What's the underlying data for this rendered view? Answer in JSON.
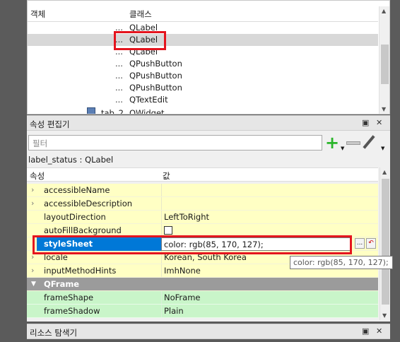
{
  "object_inspector": {
    "col_object": "객체",
    "col_class": "클래스",
    "rows": [
      {
        "dots": "...",
        "class": "QLabel"
      },
      {
        "dots": "...",
        "class": "QLabel"
      },
      {
        "dots": "...",
        "class": "QLabel"
      },
      {
        "dots": "...",
        "class": "QPushButton"
      },
      {
        "dots": "...",
        "class": "QPushButton"
      },
      {
        "dots": "...",
        "class": "QPushButton"
      },
      {
        "dots": "...",
        "class": "QTextEdit"
      }
    ],
    "partial_row": {
      "object": "tab_2",
      "class": "QWidget"
    }
  },
  "property_editor": {
    "title": "속성 편집기",
    "filter_placeholder": "필터",
    "object_label": "label_status : QLabel",
    "col_property": "속성",
    "col_value": "값",
    "rows": [
      {
        "name": "accessibleName",
        "value": ""
      },
      {
        "name": "accessibleDescription",
        "value": ""
      },
      {
        "name": "layoutDirection",
        "value": "LeftToRight"
      },
      {
        "name": "autoFillBackground",
        "value": ""
      },
      {
        "name": "styleSheet",
        "value": "color: rgb(85, 170, 127);"
      },
      {
        "name": "locale",
        "value": "Korean, South Korea"
      },
      {
        "name": "inputMethodHints",
        "value": "ImhNone"
      },
      {
        "name": "QFrame",
        "value": ""
      },
      {
        "name": "frameShape",
        "value": "NoFrame"
      },
      {
        "name": "frameShadow",
        "value": "Plain"
      }
    ],
    "tooltip": "color: rgb(85, 170, 127);",
    "more_button": "...",
    "reset_button": "↶"
  },
  "resource_browser": {
    "title": "리소스 탐색기"
  },
  "colors": {
    "selection": "#0078d7",
    "highlight_box": "#e4141e",
    "yellow_row": "#ffffc4",
    "green_row": "#c9f5c9"
  }
}
